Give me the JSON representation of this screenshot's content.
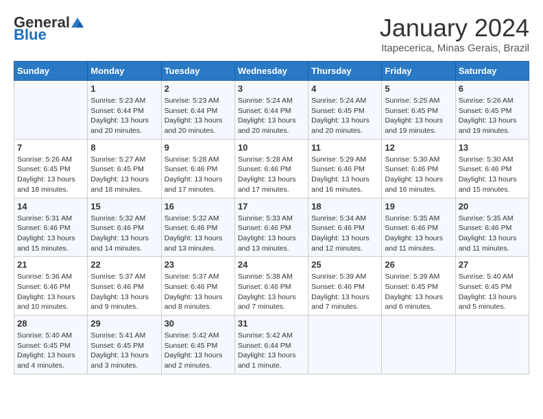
{
  "header": {
    "logo_general": "General",
    "logo_blue": "Blue",
    "month_title": "January 2024",
    "subtitle": "Itapecerica, Minas Gerais, Brazil"
  },
  "days_of_week": [
    "Sunday",
    "Monday",
    "Tuesday",
    "Wednesday",
    "Thursday",
    "Friday",
    "Saturday"
  ],
  "weeks": [
    [
      {
        "day": "",
        "info": ""
      },
      {
        "day": "1",
        "info": "Sunrise: 5:23 AM\nSunset: 6:44 PM\nDaylight: 13 hours and 20 minutes."
      },
      {
        "day": "2",
        "info": "Sunrise: 5:23 AM\nSunset: 6:44 PM\nDaylight: 13 hours and 20 minutes."
      },
      {
        "day": "3",
        "info": "Sunrise: 5:24 AM\nSunset: 6:44 PM\nDaylight: 13 hours and 20 minutes."
      },
      {
        "day": "4",
        "info": "Sunrise: 5:24 AM\nSunset: 6:45 PM\nDaylight: 13 hours and 20 minutes."
      },
      {
        "day": "5",
        "info": "Sunrise: 5:25 AM\nSunset: 6:45 PM\nDaylight: 13 hours and 19 minutes."
      },
      {
        "day": "6",
        "info": "Sunrise: 5:26 AM\nSunset: 6:45 PM\nDaylight: 13 hours and 19 minutes."
      }
    ],
    [
      {
        "day": "7",
        "info": "Sunrise: 5:26 AM\nSunset: 6:45 PM\nDaylight: 13 hours and 18 minutes."
      },
      {
        "day": "8",
        "info": "Sunrise: 5:27 AM\nSunset: 6:45 PM\nDaylight: 13 hours and 18 minutes."
      },
      {
        "day": "9",
        "info": "Sunrise: 5:28 AM\nSunset: 6:46 PM\nDaylight: 13 hours and 17 minutes."
      },
      {
        "day": "10",
        "info": "Sunrise: 5:28 AM\nSunset: 6:46 PM\nDaylight: 13 hours and 17 minutes."
      },
      {
        "day": "11",
        "info": "Sunrise: 5:29 AM\nSunset: 6:46 PM\nDaylight: 13 hours and 16 minutes."
      },
      {
        "day": "12",
        "info": "Sunrise: 5:30 AM\nSunset: 6:46 PM\nDaylight: 13 hours and 16 minutes."
      },
      {
        "day": "13",
        "info": "Sunrise: 5:30 AM\nSunset: 6:46 PM\nDaylight: 13 hours and 15 minutes."
      }
    ],
    [
      {
        "day": "14",
        "info": "Sunrise: 5:31 AM\nSunset: 6:46 PM\nDaylight: 13 hours and 15 minutes."
      },
      {
        "day": "15",
        "info": "Sunrise: 5:32 AM\nSunset: 6:46 PM\nDaylight: 13 hours and 14 minutes."
      },
      {
        "day": "16",
        "info": "Sunrise: 5:32 AM\nSunset: 6:46 PM\nDaylight: 13 hours and 13 minutes."
      },
      {
        "day": "17",
        "info": "Sunrise: 5:33 AM\nSunset: 6:46 PM\nDaylight: 13 hours and 13 minutes."
      },
      {
        "day": "18",
        "info": "Sunrise: 5:34 AM\nSunset: 6:46 PM\nDaylight: 13 hours and 12 minutes."
      },
      {
        "day": "19",
        "info": "Sunrise: 5:35 AM\nSunset: 6:46 PM\nDaylight: 13 hours and 11 minutes."
      },
      {
        "day": "20",
        "info": "Sunrise: 5:35 AM\nSunset: 6:46 PM\nDaylight: 13 hours and 11 minutes."
      }
    ],
    [
      {
        "day": "21",
        "info": "Sunrise: 5:36 AM\nSunset: 6:46 PM\nDaylight: 13 hours and 10 minutes."
      },
      {
        "day": "22",
        "info": "Sunrise: 5:37 AM\nSunset: 6:46 PM\nDaylight: 13 hours and 9 minutes."
      },
      {
        "day": "23",
        "info": "Sunrise: 5:37 AM\nSunset: 6:46 PM\nDaylight: 13 hours and 8 minutes."
      },
      {
        "day": "24",
        "info": "Sunrise: 5:38 AM\nSunset: 6:46 PM\nDaylight: 13 hours and 7 minutes."
      },
      {
        "day": "25",
        "info": "Sunrise: 5:39 AM\nSunset: 6:46 PM\nDaylight: 13 hours and 7 minutes."
      },
      {
        "day": "26",
        "info": "Sunrise: 5:39 AM\nSunset: 6:45 PM\nDaylight: 13 hours and 6 minutes."
      },
      {
        "day": "27",
        "info": "Sunrise: 5:40 AM\nSunset: 6:45 PM\nDaylight: 13 hours and 5 minutes."
      }
    ],
    [
      {
        "day": "28",
        "info": "Sunrise: 5:40 AM\nSunset: 6:45 PM\nDaylight: 13 hours and 4 minutes."
      },
      {
        "day": "29",
        "info": "Sunrise: 5:41 AM\nSunset: 6:45 PM\nDaylight: 13 hours and 3 minutes."
      },
      {
        "day": "30",
        "info": "Sunrise: 5:42 AM\nSunset: 6:45 PM\nDaylight: 13 hours and 2 minutes."
      },
      {
        "day": "31",
        "info": "Sunrise: 5:42 AM\nSunset: 6:44 PM\nDaylight: 13 hours and 1 minute."
      },
      {
        "day": "",
        "info": ""
      },
      {
        "day": "",
        "info": ""
      },
      {
        "day": "",
        "info": ""
      }
    ]
  ]
}
